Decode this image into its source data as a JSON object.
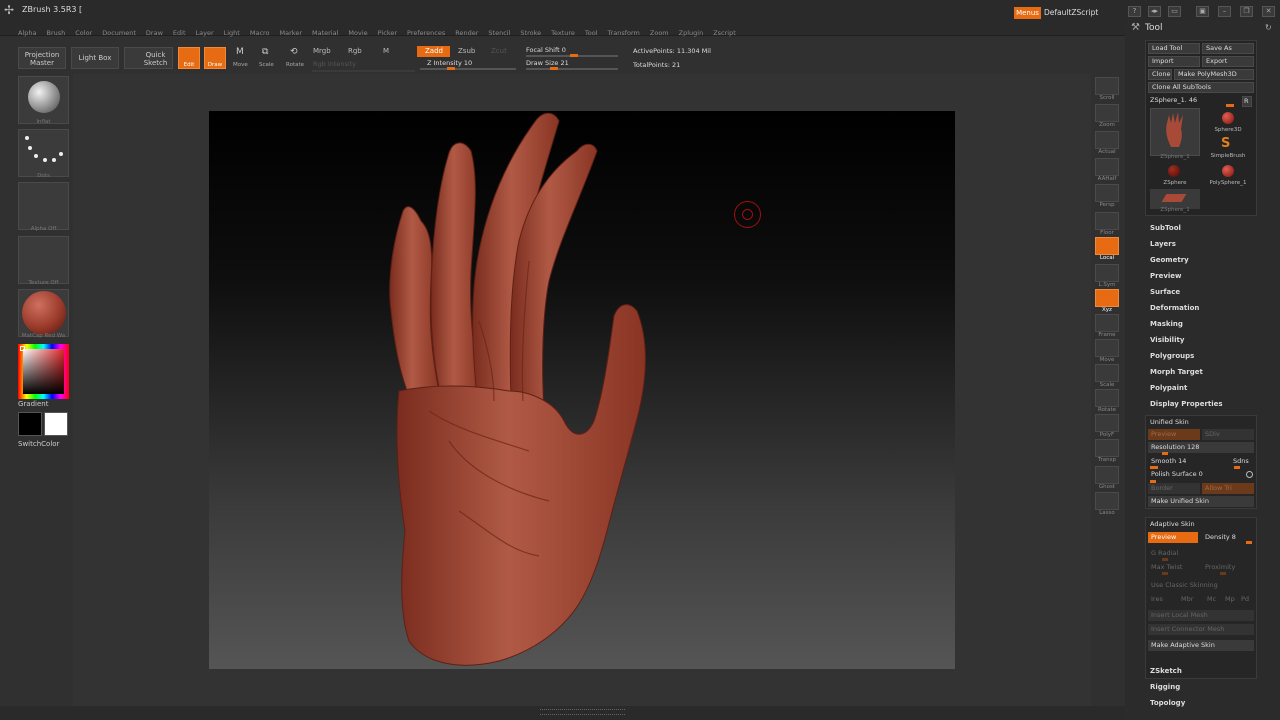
{
  "app": {
    "title": "ZBrush 3.5R3 ["
  },
  "menubar": [
    "Alpha",
    "Brush",
    "Color",
    "Document",
    "Draw",
    "Edit",
    "Layer",
    "Light",
    "Macro",
    "Marker",
    "Material",
    "Movie",
    "Picker",
    "Preferences",
    "Render",
    "Stencil",
    "Stroke",
    "Texture",
    "Tool",
    "Transform",
    "Zoom",
    "Zplugin",
    "Zscript"
  ],
  "titlebar_right": {
    "menus": "Menus",
    "script": "DefaultZScript"
  },
  "toolbar": {
    "projection_master": "Projection Master",
    "light_box": "Light Box",
    "quick_sketch": "Quick Sketch",
    "edit": "Edit",
    "draw": "Draw",
    "move": "Move",
    "scale": "Scale",
    "rotate": "Rotate",
    "mrgb": "Mrgb",
    "rgb": "Rgb",
    "m": "M",
    "rgb_intensity": "Rgb Intensity",
    "zadd": "Zadd",
    "zsub": "Zsub",
    "zcut": "Zcut",
    "z_intensity": "Z Intensity 10",
    "focal_shift": "Focal Shift 0",
    "draw_size": "Draw Size 21",
    "active_points": "ActivePoints: 11.304 Mil",
    "total_points": "TotalPoints: 21"
  },
  "left_shelf": {
    "brush": "Inflat",
    "stroke": "Dots",
    "alpha": "Alpha Off",
    "texture": "Texture Off",
    "material": "MatCap Red Wa",
    "gradient": "Gradient",
    "switch_color": "SwitchColor"
  },
  "right_shelf": [
    "Scroll",
    "Zoom",
    "Actual",
    "AAHalf",
    "Persp",
    "Floor",
    "Local",
    "L.Sym",
    "Xyz",
    "Frame",
    "Move",
    "Scale",
    "Rotate",
    "PolyF",
    "Transp",
    "Ghost",
    "Lasso"
  ],
  "tool_panel": {
    "title": "Tool",
    "load_tool": "Load Tool",
    "save_as": "Save As",
    "import": "Import",
    "export": "Export",
    "clone": "Clone",
    "make_polymesh": "Make PolyMesh3D",
    "clone_all": "Clone All SubTools",
    "current_tool": "ZSphere_1. 46",
    "r": "R",
    "tools": [
      "ZSphere_1",
      "Sphere3D",
      "SimpleBrush",
      "ZSphere",
      "PolySphere_1",
      "ZSphere_1"
    ],
    "sections": [
      "SubTool",
      "Layers",
      "Geometry",
      "Preview",
      "Surface",
      "Deformation",
      "Masking",
      "Visibility",
      "Polygroups",
      "Morph Target",
      "Polypaint",
      "Display Properties"
    ],
    "unified_skin": {
      "title": "Unified Skin",
      "preview": "Preview",
      "sdiv": "SDiv",
      "resolution": "Resolution 128",
      "smooth": "Smooth 14",
      "sdns": "Sdns",
      "polish": "Polish Surface 0",
      "border": "Border",
      "allow_tri": "Allow Tri",
      "make": "Make Unified Skin"
    },
    "adaptive_skin": {
      "title": "Adaptive Skin",
      "preview": "Preview",
      "density": "Density 8",
      "g_radial": "G Radial",
      "max_twist": "Max Twist",
      "proximity": "Proximity",
      "classic": "Use Classic Skinning",
      "ires": "Ires",
      "mbr": "Mbr",
      "mc": "Mc",
      "mp": "Mp",
      "pd": "Pd",
      "insert_local": "Insert Local Mesh",
      "insert_connector": "Insert Connector Mesh",
      "make": "Make Adaptive Skin"
    },
    "bottom_sections": [
      "ZSketch",
      "Rigging",
      "Topology"
    ]
  },
  "colors": {
    "accent": "#e76b12",
    "skin": "#a84a38"
  }
}
